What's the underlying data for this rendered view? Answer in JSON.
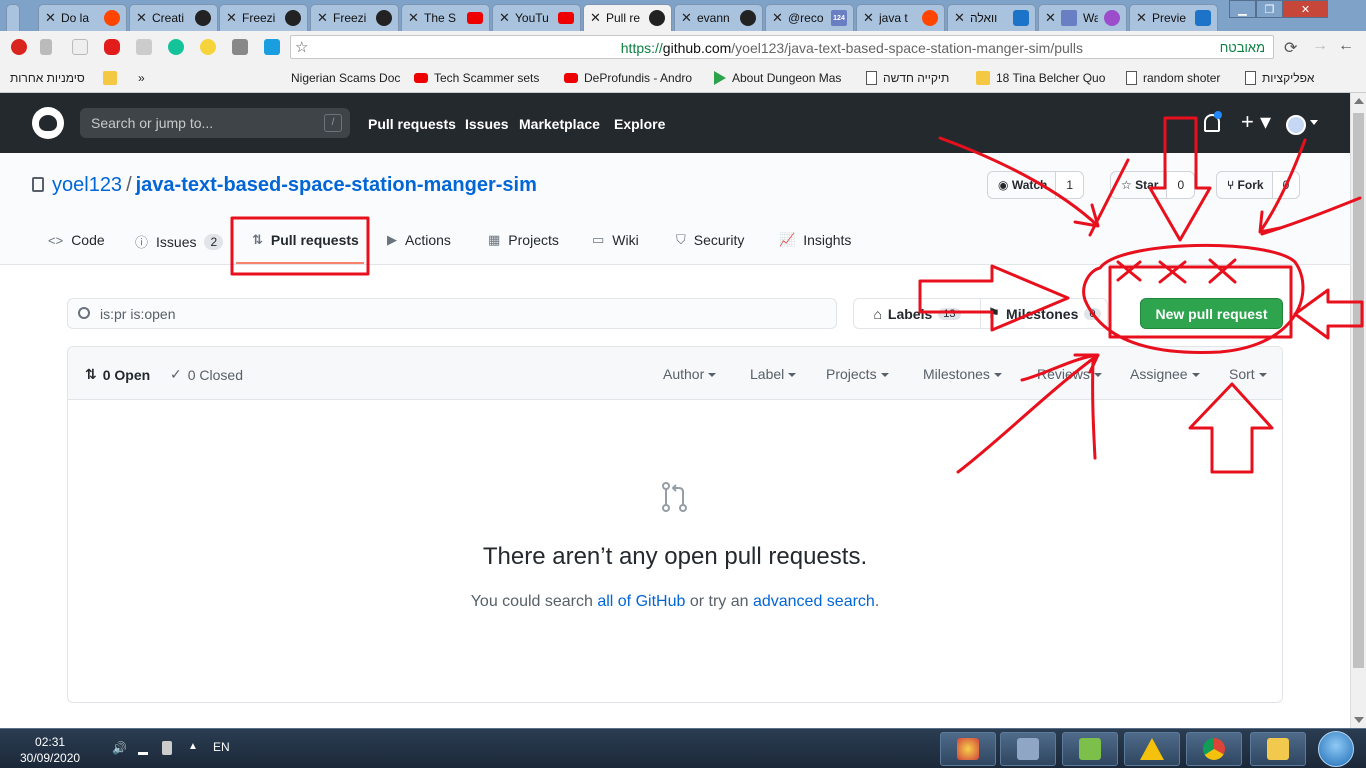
{
  "browser": {
    "tabs": [
      {
        "title": "Do la",
        "favicon": "reddit-icon"
      },
      {
        "title": "Creati",
        "favicon": "github-icon"
      },
      {
        "title": "Freezi",
        "favicon": "github-icon"
      },
      {
        "title": "Freezi",
        "favicon": "github-icon"
      },
      {
        "title": "The S",
        "favicon": "youtube-icon"
      },
      {
        "title": "YouTu",
        "favicon": "youtube-icon"
      },
      {
        "title": "Pull re",
        "favicon": "github-icon"
      },
      {
        "title": "evann",
        "favicon": "github-icon"
      },
      {
        "title": "@reco",
        "favicon": "calendar-icon"
      },
      {
        "title": "java t",
        "favicon": "reddit-icon"
      },
      {
        "title": "וואלה",
        "favicon": "walla-icon"
      },
      {
        "title": "Wa",
        "favicon": "window-icon"
      },
      {
        "title": "Previe",
        "favicon": "preview-icon"
      }
    ],
    "calendar_badge": "124",
    "url_scheme": "https://",
    "url_host": "github.com",
    "url_path": "/yoel123/java-text-based-space-station-manger-sim/pulls",
    "secure_label": "מאובטח",
    "bookmarks": [
      {
        "label": "אפליקציות",
        "icon": "apps-icon"
      },
      {
        "label": "random shoter",
        "icon": "doc-icon"
      },
      {
        "label": "18 Tina Belcher Quo",
        "icon": "doc-icon"
      },
      {
        "label": "תיקייה חדשה",
        "icon": "folder-icon"
      },
      {
        "label": "About Dungeon Mas",
        "icon": "doc-icon"
      },
      {
        "label": "DeProfundis - Andro",
        "icon": "play-store-icon"
      },
      {
        "label": "Tech Scammer sets",
        "icon": "youtube-icon"
      },
      {
        "label": "Nigerian Scams Docu",
        "icon": "youtube-icon"
      }
    ],
    "bookmarks_overflow": "»",
    "other_bookmarks": "סימניות אחרות"
  },
  "github": {
    "search_placeholder": "Search or jump to...",
    "search_shortcut": "/",
    "nav": [
      "Pull requests",
      "Issues",
      "Marketplace",
      "Explore"
    ],
    "repo_owner": "yoel123",
    "repo_sep": "/",
    "repo_name": "java-text-based-space-station-manger-sim",
    "watch_label": "Watch",
    "watch_count": "1",
    "star_label": "Star",
    "star_count": "0",
    "fork_label": "Fork",
    "fork_count": "0",
    "tabs": {
      "code": "Code",
      "issues": "Issues",
      "issues_count": "2",
      "pulls": "Pull requests",
      "actions": "Actions",
      "projects": "Projects",
      "wiki": "Wiki",
      "security": "Security",
      "insights": "Insights"
    },
    "filter_value": "is:pr is:open",
    "labels_label": "Labels",
    "labels_count": "13",
    "milestones_label": "Milestones",
    "milestones_count": "0",
    "new_pr_label": "New pull request",
    "open_label": "0 Open",
    "closed_label": "0 Closed",
    "filters": [
      "Author",
      "Label",
      "Projects",
      "Milestones",
      "Reviews",
      "Assignee",
      "Sort"
    ],
    "blank_title": "There aren’t any open pull requests.",
    "blank_prefix": "You could search ",
    "blank_link1": "all of GitHub",
    "blank_mid": " or try an ",
    "blank_link2": "advanced search",
    "blank_suffix": "."
  },
  "taskbar": {
    "time": "02:31",
    "date": "30/09/2020",
    "lang": "EN"
  },
  "colors": {
    "annotation_red": "#e8101d",
    "gh_header": "#24292e",
    "gh_green": "#2ea44f",
    "gh_link": "#0366d6",
    "tab_accent": "#f9826c"
  }
}
